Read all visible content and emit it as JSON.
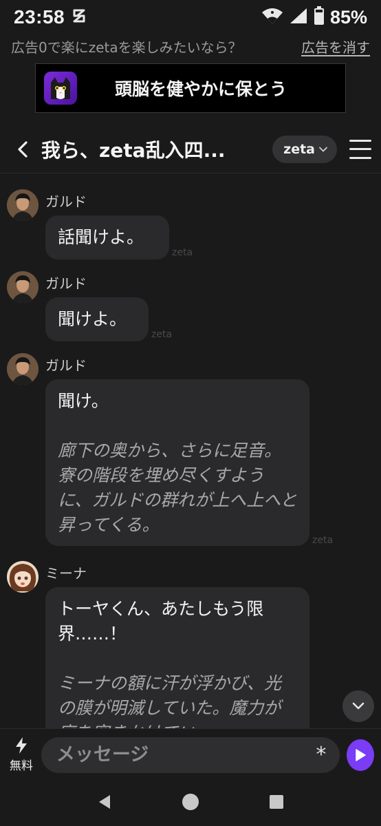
{
  "status": {
    "time": "23:58",
    "battery": "85%"
  },
  "ad": {
    "promo_text": "広告0で楽にzetaを楽しみたいなら？",
    "remove_label": "広告を消す",
    "banner_text": "頭脳を健やかに保とう"
  },
  "header": {
    "title": "我ら、zeta乱入四...",
    "model_label": "zeta"
  },
  "messages": [
    {
      "sender": "ガルド",
      "text": "話聞けよ。",
      "tag": "zeta"
    },
    {
      "sender": "ガルド",
      "text": "聞けよ。",
      "tag": "zeta"
    },
    {
      "sender": "ガルド",
      "text": "聞け。",
      "narration": "廊下の奥から、さらに足音。寮の階段を埋め尽くすように、ガルドの群れが上へ上へと昇ってくる。",
      "tag": "zeta"
    },
    {
      "sender": "ミーナ",
      "text": "トーヤくん、あたしもう限界……！",
      "narration": "ミーナの額に汗が浮かび、光の膜が明滅していた。魔力が底を突きかけてい"
    }
  ],
  "composer": {
    "free_label": "無料",
    "placeholder": "メッセージ",
    "asterisk": "*"
  },
  "colors": {
    "accent": "#7a3cf4",
    "background": "#1a1a1b",
    "bubble": "#2a2a2c"
  }
}
